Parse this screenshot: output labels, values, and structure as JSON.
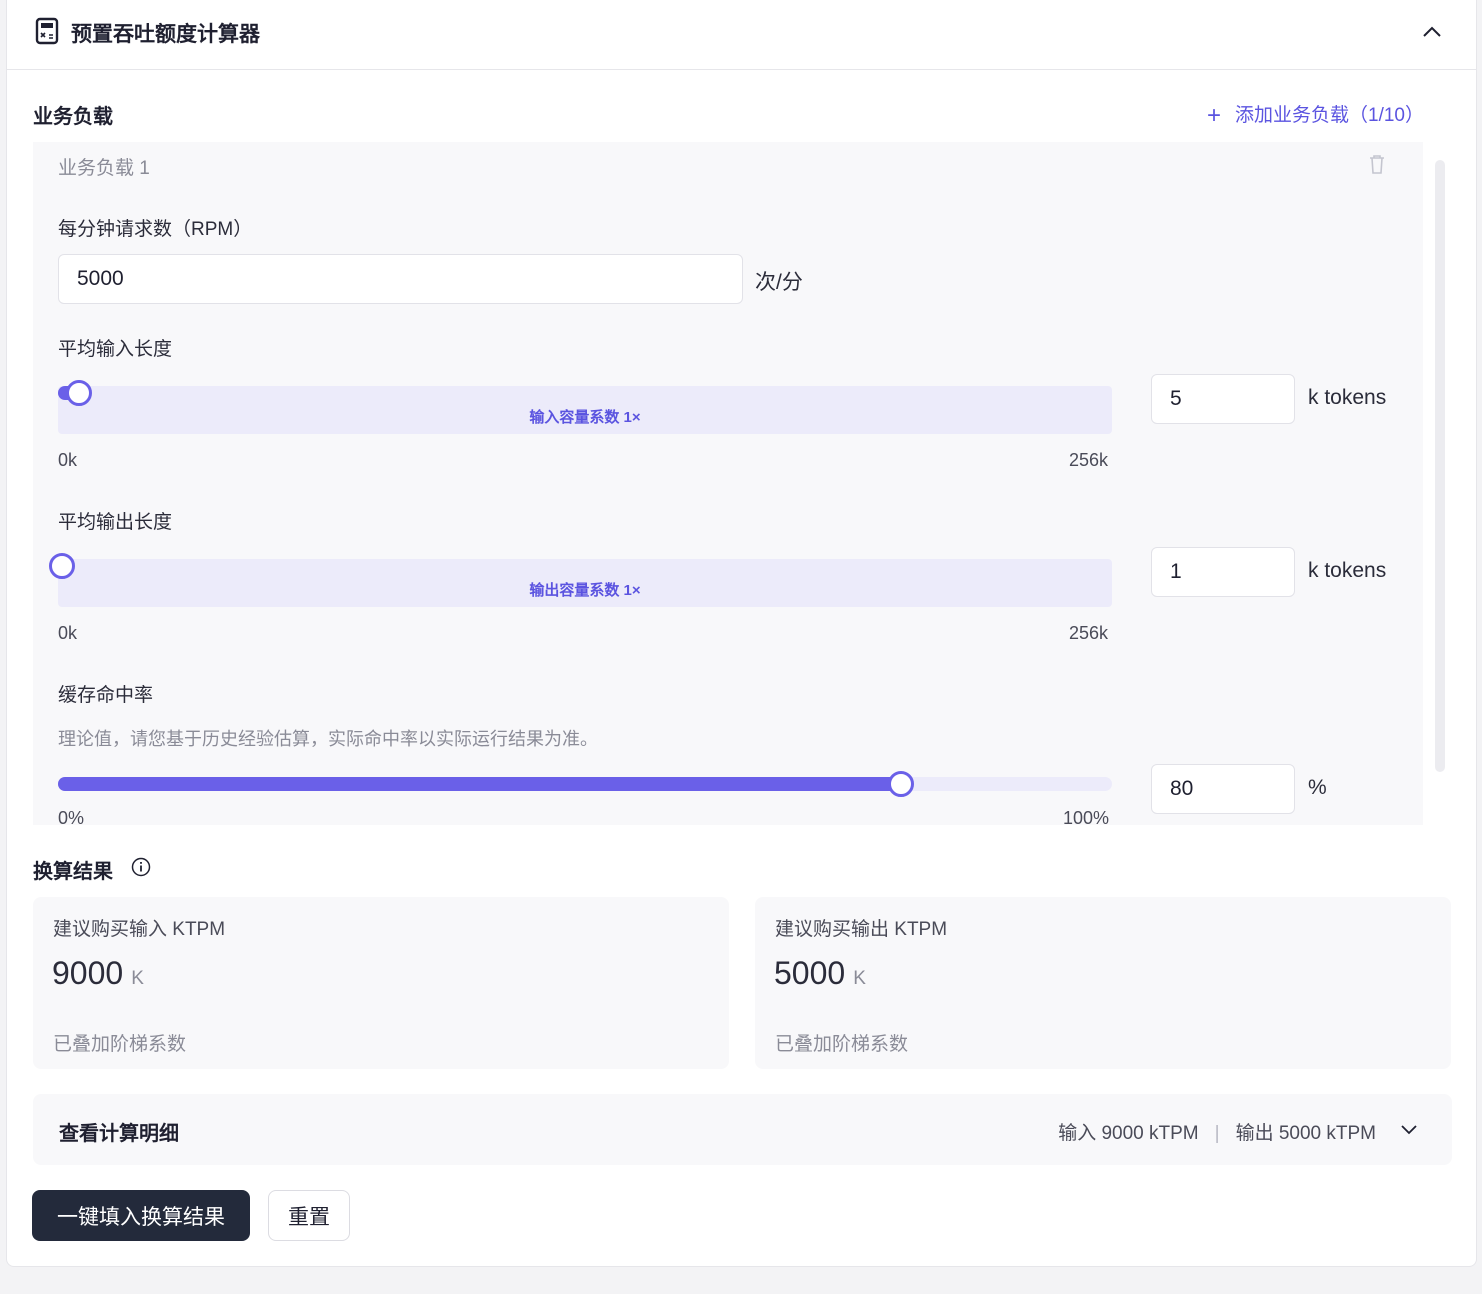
{
  "header": {
    "title": "预置吞吐额度计算器",
    "collapse_icon": "chevron-up-icon"
  },
  "workloads_section": {
    "title": "业务负载",
    "add_label": "添加业务负载（1/10）",
    "add_icon": "plus-icon"
  },
  "workload": {
    "name": "业务负载 1",
    "rpm": {
      "label": "每分钟请求数（RPM）",
      "value": "5000",
      "unit": "次/分"
    },
    "input_length": {
      "label": "平均输入长度",
      "value": "5",
      "unit": "k tokens",
      "band_label": "输入容量系数 1×",
      "min_label": "0k",
      "max_label": "256k",
      "slider_fraction": 0.0195
    },
    "output_length": {
      "label": "平均输出长度",
      "value": "1",
      "unit": "k tokens",
      "band_label": "输出容量系数 1×",
      "min_label": "0k",
      "max_label": "256k",
      "slider_fraction": 0.0039
    },
    "cache_hit": {
      "label": "缓存命中率",
      "hint": "理论值，请您基于历史经验估算，实际命中率以实际运行结果为准。",
      "value": "80",
      "unit": "%",
      "min_label": "0%",
      "max_label": "100%",
      "slider_fraction": 0.8
    }
  },
  "results": {
    "title": "换算结果",
    "input": {
      "label": "建议购买输入 KTPM",
      "value": "9000",
      "unit": "K",
      "note": "已叠加阶梯系数"
    },
    "output": {
      "label": "建议购买输出 KTPM",
      "value": "5000",
      "unit": "K",
      "note": "已叠加阶梯系数"
    }
  },
  "detail": {
    "title": "查看计算明细",
    "input_summary": "输入 9000 kTPM",
    "separator": "|",
    "output_summary": "输出 5000 kTPM"
  },
  "actions": {
    "apply_label": "一键填入换算结果",
    "reset_label": "重置"
  },
  "colors": {
    "accent": "#6a60e8",
    "primary_button": "#232a3b",
    "link": "#5b54e0"
  }
}
